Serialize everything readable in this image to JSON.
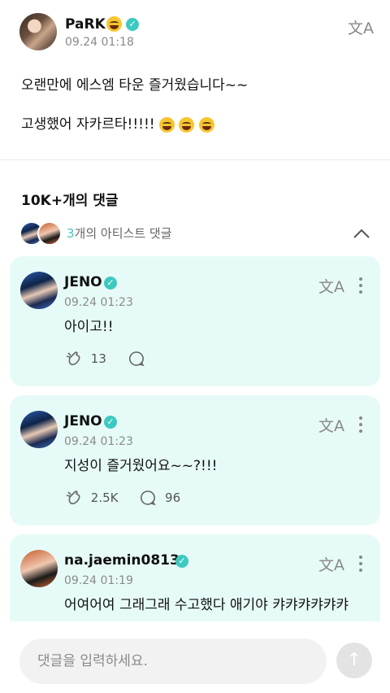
{
  "post": {
    "author": "PaRK",
    "time": "09.24 01:18",
    "line1": "오랜만에 에스엠 타운 즐거웠습니다~~",
    "line2": "고생했어 자카르타!!!!!"
  },
  "comments_header": "10K+개의 댓글",
  "artist_comments": {
    "count": "3",
    "label": "개의 아티스트 댓글"
  },
  "translate_glyph": "文A",
  "verified_glyph": "✓",
  "comments": [
    {
      "author": "JENO",
      "time": "09.24 01:23",
      "text": "아이고!!",
      "reactions": "13",
      "replies": ""
    },
    {
      "author": "JENO",
      "time": "09.24 01:23",
      "text": "지성이 즐거웠어요~~?!!!",
      "reactions": "2.5K",
      "replies": "96"
    },
    {
      "author": "na.jaemin0813",
      "time": "09.24 01:19",
      "text": "어여어여 그래그래 수고했다 애기야 캬캬캬캬캬캬"
    }
  ],
  "input": {
    "placeholder": "댓글을 입력하세요."
  },
  "send_glyph": "↑",
  "colors": {
    "accent": "#3cc9c0",
    "card_bg": "#e6fbf8"
  }
}
